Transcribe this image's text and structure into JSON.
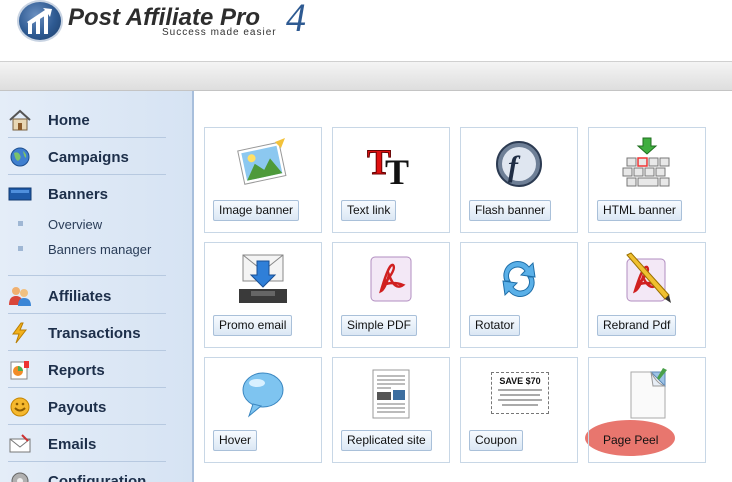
{
  "app": {
    "title": "Post Affiliate Pro",
    "version": "4",
    "tagline": "Success made easier"
  },
  "sidebar": {
    "items": [
      {
        "label": "Home",
        "icon": "house-icon"
      },
      {
        "label": "Campaigns",
        "icon": "globe-icon"
      },
      {
        "label": "Banners",
        "icon": "banner-icon"
      },
      {
        "label": "Affiliates",
        "icon": "users-icon"
      },
      {
        "label": "Transactions",
        "icon": "lightning-icon"
      },
      {
        "label": "Reports",
        "icon": "reports-icon"
      },
      {
        "label": "Payouts",
        "icon": "coin-icon"
      },
      {
        "label": "Emails",
        "icon": "envelope-icon"
      },
      {
        "label": "Configuration",
        "icon": "gear-icon"
      }
    ],
    "banner_subitems": [
      {
        "label": "Overview"
      },
      {
        "label": "Banners manager"
      }
    ]
  },
  "banner_types": [
    {
      "label": "Image banner",
      "icon": "image-picture-icon"
    },
    {
      "label": "Text link",
      "icon": "text-tt-icon"
    },
    {
      "label": "Flash banner",
      "icon": "flash-icon"
    },
    {
      "label": "HTML banner",
      "icon": "html-keyboard-icon"
    },
    {
      "label": "Promo email",
      "icon": "email-download-icon"
    },
    {
      "label": "Simple PDF",
      "icon": "pdf-icon"
    },
    {
      "label": "Rotator",
      "icon": "rotate-arrows-icon"
    },
    {
      "label": "Rebrand Pdf",
      "icon": "pdf-pencil-icon"
    },
    {
      "label": "Hover",
      "icon": "speech-bubble-icon"
    },
    {
      "label": "Replicated site",
      "icon": "document-page-icon"
    },
    {
      "label": "Coupon",
      "icon": "coupon-icon"
    },
    {
      "label": "Page Peel",
      "icon": "page-peel-icon"
    }
  ],
  "coupon": {
    "headline": "SAVE $70"
  },
  "colors": {
    "accent": "#2e5a92",
    "sidebar_bg": "#dbe6f4",
    "highlight": "#e0483e"
  }
}
